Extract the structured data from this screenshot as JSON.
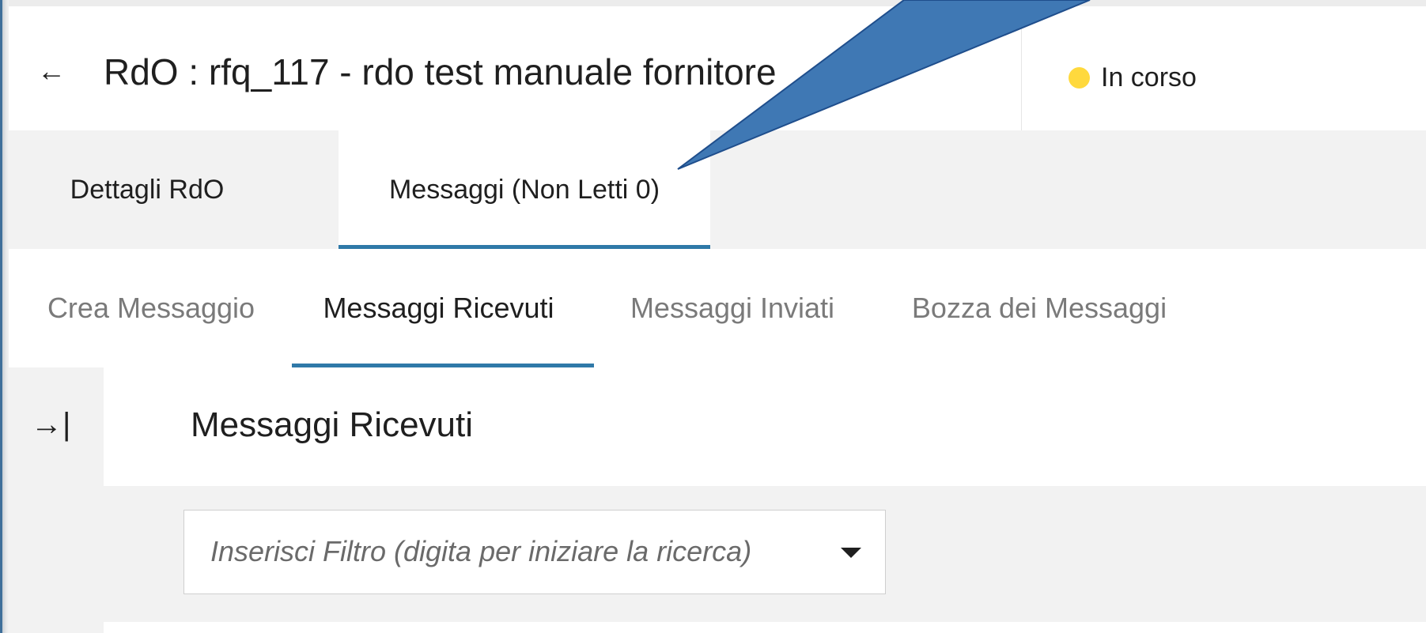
{
  "header": {
    "back_icon": "←",
    "title": "RdO : rfq_117 - rdo test manuale fornitore",
    "status": {
      "label": "In corso",
      "color": "#ffd93d"
    }
  },
  "tabs": [
    {
      "label": "Dettagli RdO",
      "active": false
    },
    {
      "label": "Messaggi (Non Letti 0)",
      "active": true
    }
  ],
  "subtabs": [
    {
      "label": "Crea Messaggio",
      "active": false
    },
    {
      "label": "Messaggi Ricevuti",
      "active": true
    },
    {
      "label": "Messaggi Inviati",
      "active": false
    },
    {
      "label": "Bozza dei Messaggi",
      "active": false
    }
  ],
  "panel": {
    "collapse_icon": "→|",
    "title": "Messaggi Ricevuti",
    "filter_placeholder": "Inserisci Filtro (digita per iniziare la ricerca)"
  },
  "colors": {
    "accent": "#2f79a8",
    "callout_fill": "#3f78b4",
    "callout_stroke": "#1f4e8c"
  }
}
